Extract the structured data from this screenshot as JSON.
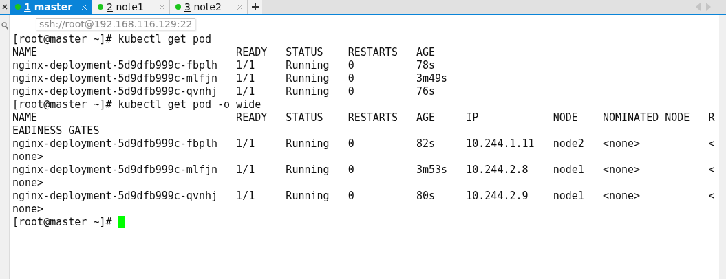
{
  "tabs": [
    {
      "number": "1",
      "label": "master",
      "selected": true
    },
    {
      "number": "2",
      "label": "note1",
      "selected": false
    },
    {
      "number": "3",
      "label": "note2",
      "selected": false
    }
  ],
  "tooltip": "ssh://root@192.168.116.129:22",
  "terminal": {
    "lines": [
      "[root@master ~]# kubectl get pod",
      "NAME                                READY   STATUS    RESTARTS   AGE",
      "nginx-deployment-5d9dfb999c-fbplh   1/1     Running   0          78s",
      "nginx-deployment-5d9dfb999c-mlfjn   1/1     Running   0          3m49s",
      "nginx-deployment-5d9dfb999c-qvnhj   1/1     Running   0          76s",
      "[root@master ~]# kubectl get pod -o wide",
      "NAME                                READY   STATUS    RESTARTS   AGE     IP            NODE    NOMINATED NODE   R",
      "EADINESS GATES",
      "nginx-deployment-5d9dfb999c-fbplh   1/1     Running   0          82s     10.244.1.11   node2   <none>           <",
      "none>",
      "nginx-deployment-5d9dfb999c-mlfjn   1/1     Running   0          3m53s   10.244.2.8    node1   <none>           <",
      "none>",
      "nginx-deployment-5d9dfb999c-qvnhj   1/1     Running   0          80s     10.244.2.9    node1   <none>           <",
      "none>",
      "[root@master ~]# "
    ],
    "cursor": true
  }
}
